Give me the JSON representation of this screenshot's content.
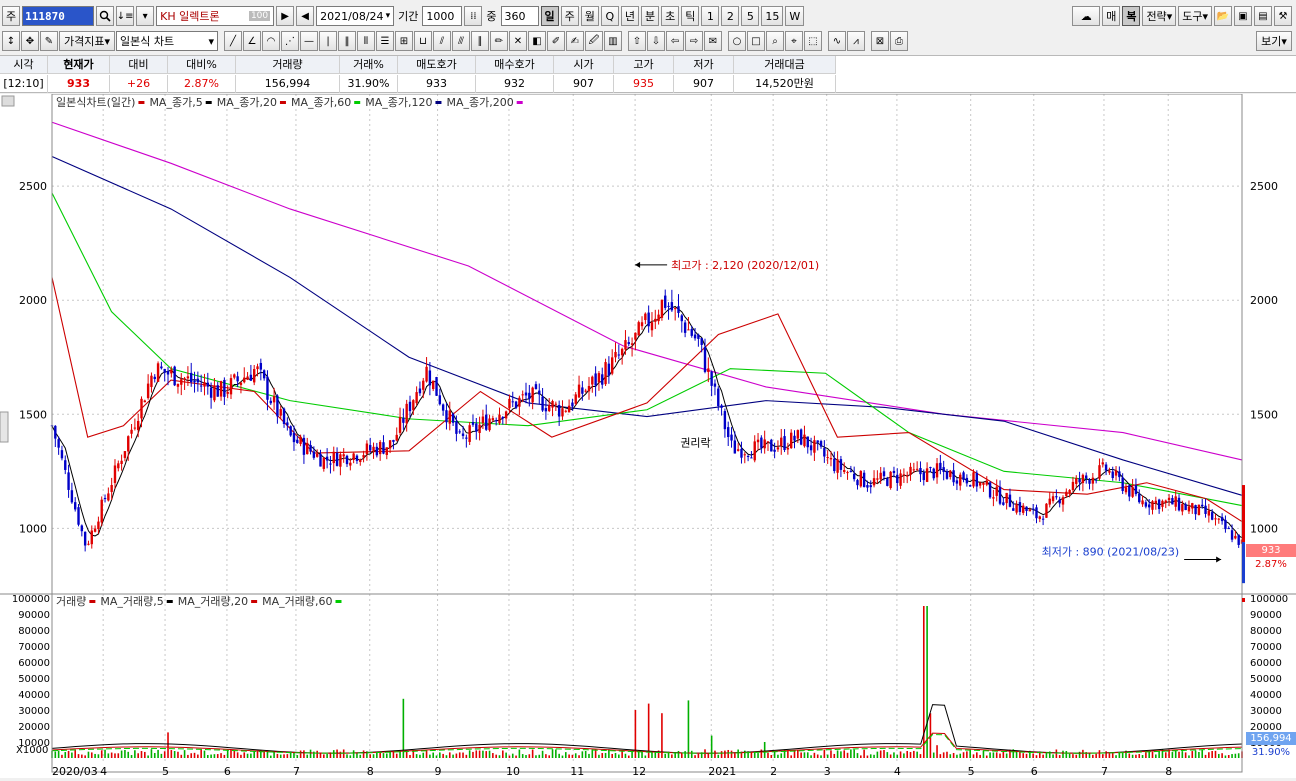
{
  "toolbar": {
    "market_label": "주",
    "code": "111870",
    "search_icon": "magnifier-icon",
    "name_prefix": "KH",
    "name": "일렉트론",
    "tick_badge": "100",
    "date": "2021/08/24",
    "period_label": "기간",
    "period_value": "1000",
    "mid_label": "중",
    "count_value": "360",
    "timeframes": [
      "일",
      "주",
      "월",
      "Q",
      "년",
      "분",
      "초",
      "틱",
      "1",
      "2",
      "5",
      "15",
      "W"
    ],
    "timeframe_selected": "일",
    "right_buttons": [
      "매",
      "복",
      "전략",
      "도구"
    ]
  },
  "toolbar2": {
    "indicator_button": "가격지표",
    "chart_type": "일본식 차트",
    "view_button": "보기"
  },
  "quote": {
    "headers": [
      "시각",
      "현재가",
      "대비",
      "대비%",
      "거래량",
      "거래%",
      "매도호가",
      "매수호가",
      "시가",
      "고가",
      "저가",
      "거래대금"
    ],
    "values": [
      "[12:10]",
      "933",
      "+26",
      "2.87%",
      "156,994",
      "31.90%",
      "933",
      "932",
      "907",
      "935",
      "907",
      "14,520만원"
    ]
  },
  "chart_data": [
    {
      "type": "candlestick",
      "legend": [
        {
          "label": "일본식차트(일간)",
          "color": "#cc0000"
        },
        {
          "label": "MA_종가,5",
          "color": "#000000"
        },
        {
          "label": "MA_종가,20",
          "color": "#cc0000"
        },
        {
          "label": "MA_종가,60",
          "color": "#00cc00"
        },
        {
          "label": "MA_종가,120",
          "color": "#000080"
        },
        {
          "label": "MA_종가,200",
          "color": "#cc00cc"
        }
      ],
      "y_ticks": [
        1000,
        1500,
        2000,
        2500
      ],
      "ylim": [
        730,
        2860
      ],
      "x_tick_labels": [
        "2020/03",
        "4",
        "5",
        "6",
        "7",
        "8",
        "9",
        "10",
        "11",
        "12",
        "2021",
        "2",
        "3",
        "4",
        "5",
        "6",
        "7",
        "8"
      ],
      "annotations": {
        "high": "최고가 : 2,120 (2020/12/01)",
        "low": "최저가 : 890 (2021/08/23)",
        "ex_rights": "권리락"
      },
      "current_price": "933",
      "current_change": "2.87%",
      "price_path": [
        [
          "2020/03",
          1450
        ],
        [
          "2020/03/20",
          920
        ],
        [
          "2020/04",
          1300
        ],
        [
          "2020/04/20",
          1700
        ],
        [
          "2020/05",
          1650
        ],
        [
          "2020/05/20",
          1600
        ],
        [
          "2020/06",
          1700
        ],
        [
          "2020/06/20",
          1400
        ],
        [
          "2020/07",
          1300
        ],
        [
          "2020/07/20",
          1330
        ],
        [
          "2020/08",
          1370
        ],
        [
          "2020/08/15",
          1700
        ],
        [
          "2020/09",
          1380
        ],
        [
          "2020/09/20",
          1500
        ],
        [
          "2020/10",
          1580
        ],
        [
          "2020/10/20",
          1520
        ],
        [
          "2020/11",
          1650
        ],
        [
          "2020/11/20",
          1800
        ],
        [
          "2020/12",
          2000
        ],
        [
          "2020/12/20",
          1820
        ],
        [
          "2021/01",
          1350
        ],
        [
          "2021/01/20",
          1350
        ],
        [
          "2021/02",
          1400
        ],
        [
          "2021/02/20",
          1280
        ],
        [
          "2021/03",
          1200
        ],
        [
          "2021/03/20",
          1230
        ],
        [
          "2021/04",
          1250
        ],
        [
          "2021/04/20",
          1220
        ],
        [
          "2021/05",
          1130
        ],
        [
          "2021/05/20",
          1050
        ],
        [
          "2021/06",
          1190
        ],
        [
          "2021/06/15",
          1260
        ],
        [
          "2021/07",
          1120
        ],
        [
          "2021/07/20",
          1110
        ],
        [
          "2021/08",
          1060
        ],
        [
          "2021/08/24",
          933
        ]
      ],
      "ma_paths": {
        "ma200": [
          [
            0,
            2780
          ],
          [
            0.1,
            2600
          ],
          [
            0.2,
            2400
          ],
          [
            0.35,
            2150
          ],
          [
            0.48,
            1800
          ],
          [
            0.6,
            1620
          ],
          [
            0.75,
            1500
          ],
          [
            0.9,
            1420
          ],
          [
            1,
            1300
          ]
        ],
        "ma120": [
          [
            0,
            2630
          ],
          [
            0.1,
            2400
          ],
          [
            0.2,
            2100
          ],
          [
            0.3,
            1750
          ],
          [
            0.4,
            1550
          ],
          [
            0.5,
            1490
          ],
          [
            0.6,
            1560
          ],
          [
            0.7,
            1530
          ],
          [
            0.8,
            1470
          ],
          [
            0.9,
            1300
          ],
          [
            1,
            1145
          ]
        ],
        "ma60": [
          [
            0,
            2470
          ],
          [
            0.05,
            1950
          ],
          [
            0.1,
            1700
          ],
          [
            0.2,
            1560
          ],
          [
            0.3,
            1480
          ],
          [
            0.4,
            1450
          ],
          [
            0.5,
            1520
          ],
          [
            0.57,
            1700
          ],
          [
            0.65,
            1680
          ],
          [
            0.72,
            1420
          ],
          [
            0.8,
            1250
          ],
          [
            0.9,
            1200
          ],
          [
            1,
            1100
          ]
        ],
        "ma20": [
          [
            0,
            2100
          ],
          [
            0.03,
            1400
          ],
          [
            0.06,
            1450
          ],
          [
            0.1,
            1650
          ],
          [
            0.17,
            1600
          ],
          [
            0.22,
            1330
          ],
          [
            0.3,
            1340
          ],
          [
            0.36,
            1600
          ],
          [
            0.42,
            1400
          ],
          [
            0.5,
            1550
          ],
          [
            0.56,
            1850
          ],
          [
            0.61,
            1940
          ],
          [
            0.66,
            1400
          ],
          [
            0.72,
            1420
          ],
          [
            0.8,
            1170
          ],
          [
            0.87,
            1150
          ],
          [
            0.92,
            1200
          ],
          [
            0.97,
            1130
          ],
          [
            1,
            1030
          ]
        ]
      }
    },
    {
      "type": "bar",
      "legend": [
        {
          "label": "거래량",
          "color": "#cc0000"
        },
        {
          "label": "MA_거래량,5",
          "color": "#000000"
        },
        {
          "label": "MA_거래량,20",
          "color": "#cc0000"
        },
        {
          "label": "MA_거래량,60",
          "color": "#00cc00"
        }
      ],
      "y_ticks": [
        10000,
        20000,
        30000,
        40000,
        50000,
        60000,
        70000,
        80000,
        90000,
        100000
      ],
      "ylim": [
        0,
        100000
      ],
      "unit_label": "X1000",
      "spikes": [
        [
          0.097,
          16000
        ],
        [
          0.295,
          37000
        ],
        [
          0.49,
          30000
        ],
        [
          0.502,
          34000
        ],
        [
          0.512,
          28000
        ],
        [
          0.535,
          36000
        ],
        [
          0.555,
          14000
        ],
        [
          0.6,
          10000
        ],
        [
          0.734,
          95000
        ],
        [
          0.737,
          28000
        ],
        [
          0.745,
          8000
        ]
      ],
      "current_volume": "156,994",
      "current_ratio": "31.90%"
    }
  ]
}
